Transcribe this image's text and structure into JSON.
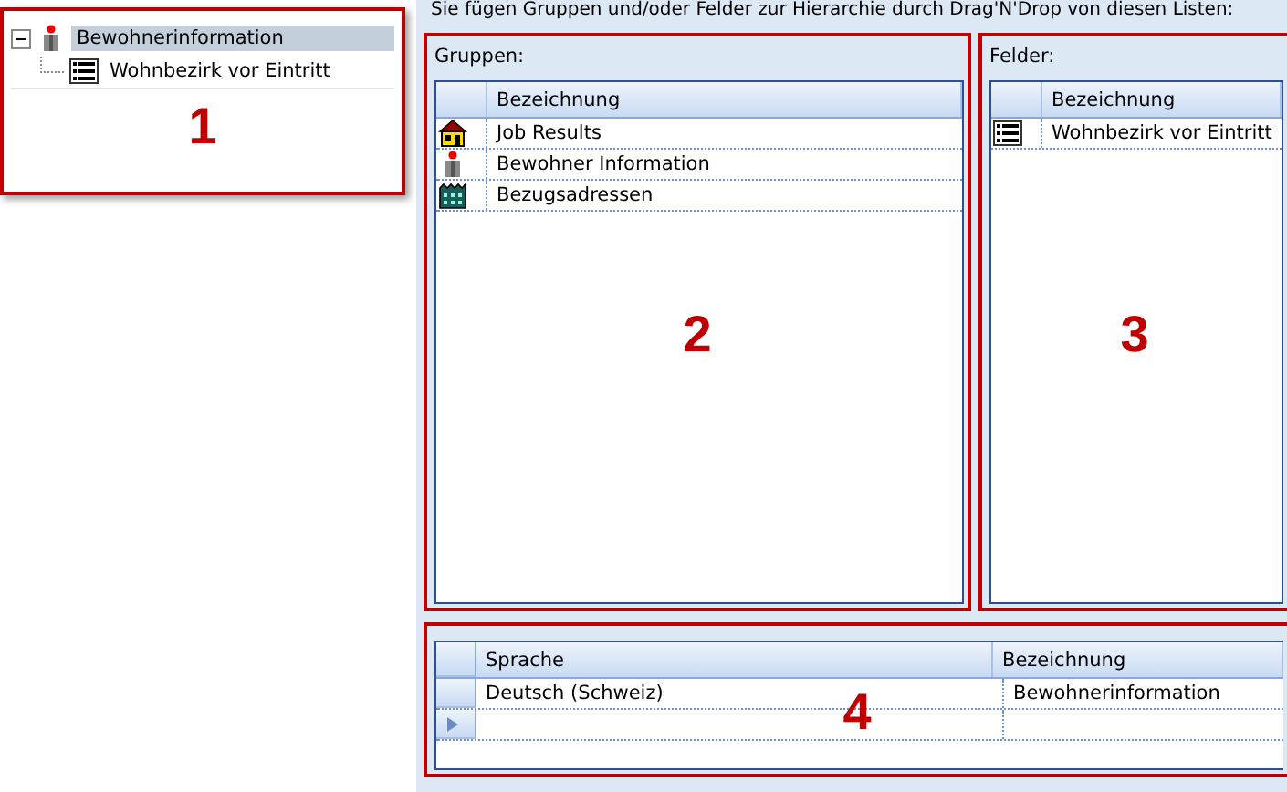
{
  "tree_panel": {
    "callout": "1",
    "nodes": [
      {
        "label": "Bewohnerinformation",
        "kind": "person",
        "selected": true,
        "expanded": true,
        "children": [
          {
            "label": "Wohnbezirk vor Eintritt",
            "kind": "list",
            "selected": false
          }
        ]
      }
    ]
  },
  "instruction": "Sie fügen Gruppen und/oder Felder zur Hierarchie durch Drag'N'Drop von diesen Listen:",
  "groups": {
    "callout": "2",
    "label": "Gruppen:",
    "columns": [
      "Bezeichnung"
    ],
    "rows": [
      {
        "kind": "house",
        "name": "Job Results"
      },
      {
        "kind": "person",
        "name": "Bewohner Information"
      },
      {
        "kind": "building",
        "name": "Bezugsadressen"
      }
    ]
  },
  "fields": {
    "callout": "3",
    "label": "Felder:",
    "columns": [
      "Bezeichnung"
    ],
    "rows": [
      {
        "kind": "list",
        "name": "Wohnbezirk vor Eintritt"
      }
    ]
  },
  "translations": {
    "callout": "4",
    "columns": [
      "Sprache",
      "Bezeichnung"
    ],
    "rows": [
      {
        "current": false,
        "cells": [
          "Deutsch (Schweiz)",
          "Bewohnerinformation"
        ]
      },
      {
        "current": true
      }
    ]
  }
}
